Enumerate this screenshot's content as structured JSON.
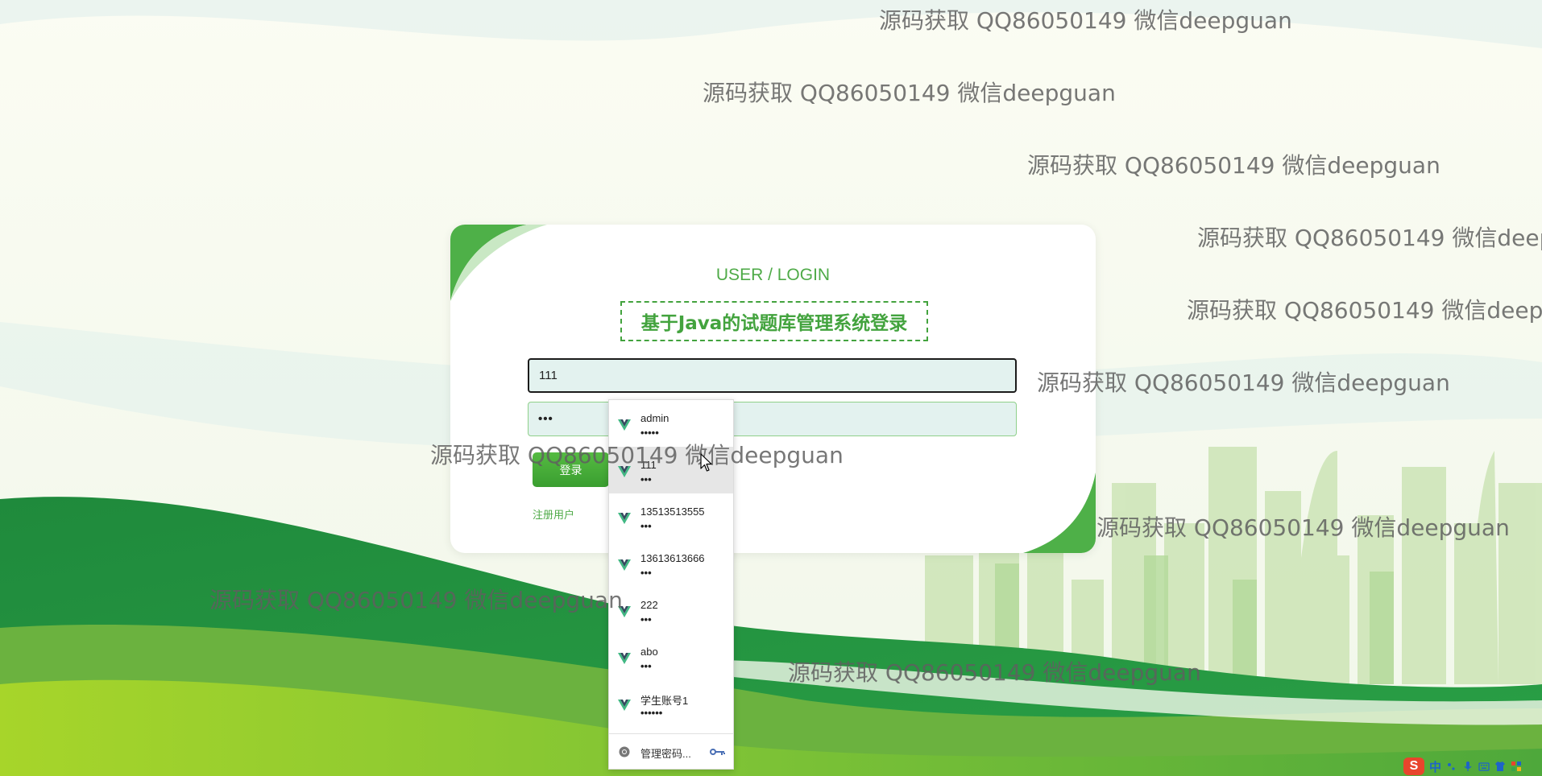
{
  "watermark_text": "源码获取 QQ86050149 微信deepguan",
  "login": {
    "subtitle": "USER / LOGIN",
    "title": "基于Java的试题库管理系统登录",
    "username_value": "111",
    "password_mask": "•••",
    "login_button": "登录",
    "register_link": "注册用户"
  },
  "autofill": {
    "items": [
      {
        "account": "admin",
        "mask": "•••••"
      },
      {
        "account": "111",
        "mask": "•••"
      },
      {
        "account": "13513513555",
        "mask": "•••"
      },
      {
        "account": "13613613666",
        "mask": "•••"
      },
      {
        "account": "222",
        "mask": "•••"
      },
      {
        "account": "abo",
        "mask": "•••"
      },
      {
        "account": "学生账号1",
        "mask": "••••••"
      }
    ],
    "manage_label": "管理密码..."
  },
  "tray": {
    "ime_logo": "S",
    "ime_mode": "中"
  },
  "colors": {
    "brand_green": "#43a33e",
    "input_bg": "#e3f2ef"
  }
}
